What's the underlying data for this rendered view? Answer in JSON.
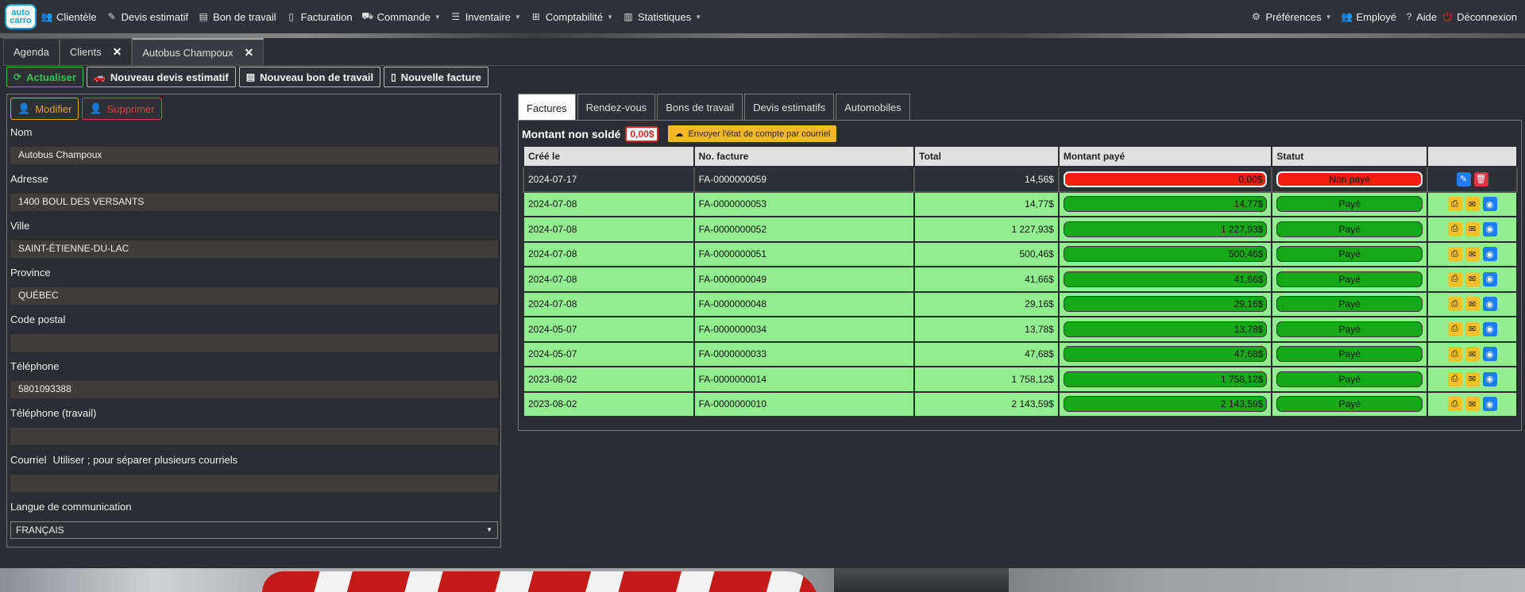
{
  "navbar": {
    "logo_line1": "auto",
    "logo_line2": "carro",
    "items": [
      {
        "label": "Clientèle",
        "icon": "users-icon",
        "glyph": "👥",
        "caret": false
      },
      {
        "label": "Devis estimatif",
        "icon": "edit-icon",
        "glyph": "✎",
        "caret": false
      },
      {
        "label": "Bon de travail",
        "icon": "clipboard-icon",
        "glyph": "▤",
        "caret": false
      },
      {
        "label": "Facturation",
        "icon": "file-icon",
        "glyph": "▯",
        "caret": false
      },
      {
        "label": "Commande",
        "icon": "basket-icon",
        "glyph": "⛟",
        "caret": true
      },
      {
        "label": "Inventaire",
        "icon": "list-icon",
        "glyph": "☰",
        "caret": true
      },
      {
        "label": "Comptabilité",
        "icon": "accounting-icon",
        "glyph": "⊞",
        "caret": true
      },
      {
        "label": "Statistiques",
        "icon": "chart-icon",
        "glyph": "▥",
        "caret": true
      }
    ],
    "right": {
      "preferences": "Préférences",
      "employee": "Employé",
      "help": "Aide",
      "logout": "Déconnexion"
    }
  },
  "page_tabs": [
    {
      "label": "Agenda",
      "closable": false
    },
    {
      "label": "Clients",
      "closable": true
    },
    {
      "label": "Autobus Champoux",
      "closable": true
    }
  ],
  "actions": {
    "refresh": "Actualiser",
    "new_quote": "Nouveau devis estimatif",
    "new_work_order": "Nouveau bon de travail",
    "new_invoice": "Nouvelle facture"
  },
  "client": {
    "edit": "Modifier",
    "delete": "Supprimer",
    "name_label": "Nom",
    "name": "Autobus Champoux",
    "address_label": "Adresse",
    "address": "1400 BOUL DES VERSANTS",
    "city_label": "Ville",
    "city": "SAINT-ÉTIENNE-DU-LAC",
    "province_label": "Province",
    "province": "QUÉBEC",
    "postal_label": "Code postal",
    "postal": "",
    "phone_label": "Téléphone",
    "phone": "5801093388",
    "work_phone_label": "Téléphone (travail)",
    "work_phone": "",
    "email_label": "Courriel",
    "email_hint": "Utiliser ; pour séparer plusieurs courriels",
    "email": "",
    "language_label": "Langue de communication",
    "language": "FRANÇAIS"
  },
  "right_tabs": [
    "Factures",
    "Rendez-vous",
    "Bons de travail",
    "Devis estimatifs",
    "Automobiles"
  ],
  "balance": {
    "label": "Montant non soldé",
    "amount": "0,00$",
    "send_button": "Envoyer l'état de compte par courriel"
  },
  "invoices": {
    "headers": [
      "Créé le",
      "No. facture",
      "Total",
      "Montant payé",
      "Statut",
      ""
    ],
    "rows": [
      {
        "date": "2024-07-17",
        "number": "FA-0000000059",
        "total": "14,56$",
        "paid": "0,00$",
        "status": "Non payé",
        "state": "unpaid"
      },
      {
        "date": "2024-07-08",
        "number": "FA-0000000053",
        "total": "14,77$",
        "paid": "14,77$",
        "status": "Payé",
        "state": "paid"
      },
      {
        "date": "2024-07-08",
        "number": "FA-0000000052",
        "total": "1 227,93$",
        "paid": "1 227,93$",
        "status": "Payé",
        "state": "paid"
      },
      {
        "date": "2024-07-08",
        "number": "FA-0000000051",
        "total": "500,46$",
        "paid": "500,46$",
        "status": "Payé",
        "state": "paid"
      },
      {
        "date": "2024-07-08",
        "number": "FA-0000000049",
        "total": "41,66$",
        "paid": "41,66$",
        "status": "Payé",
        "state": "paid"
      },
      {
        "date": "2024-07-08",
        "number": "FA-0000000048",
        "total": "29,16$",
        "paid": "29,16$",
        "status": "Payé",
        "state": "paid"
      },
      {
        "date": "2024-05-07",
        "number": "FA-0000000034",
        "total": "13,78$",
        "paid": "13,78$",
        "status": "Payé",
        "state": "paid"
      },
      {
        "date": "2024-05-07",
        "number": "FA-0000000033",
        "total": "47,68$",
        "paid": "47,68$",
        "status": "Payé",
        "state": "paid"
      },
      {
        "date": "2023-08-02",
        "number": "FA-0000000014",
        "total": "1 758,12$",
        "paid": "1 758,12$",
        "status": "Payé",
        "state": "paid"
      },
      {
        "date": "2023-08-02",
        "number": "FA-0000000010",
        "total": "2 143,59$",
        "paid": "2 143,59$",
        "status": "Payé",
        "state": "paid"
      }
    ]
  }
}
